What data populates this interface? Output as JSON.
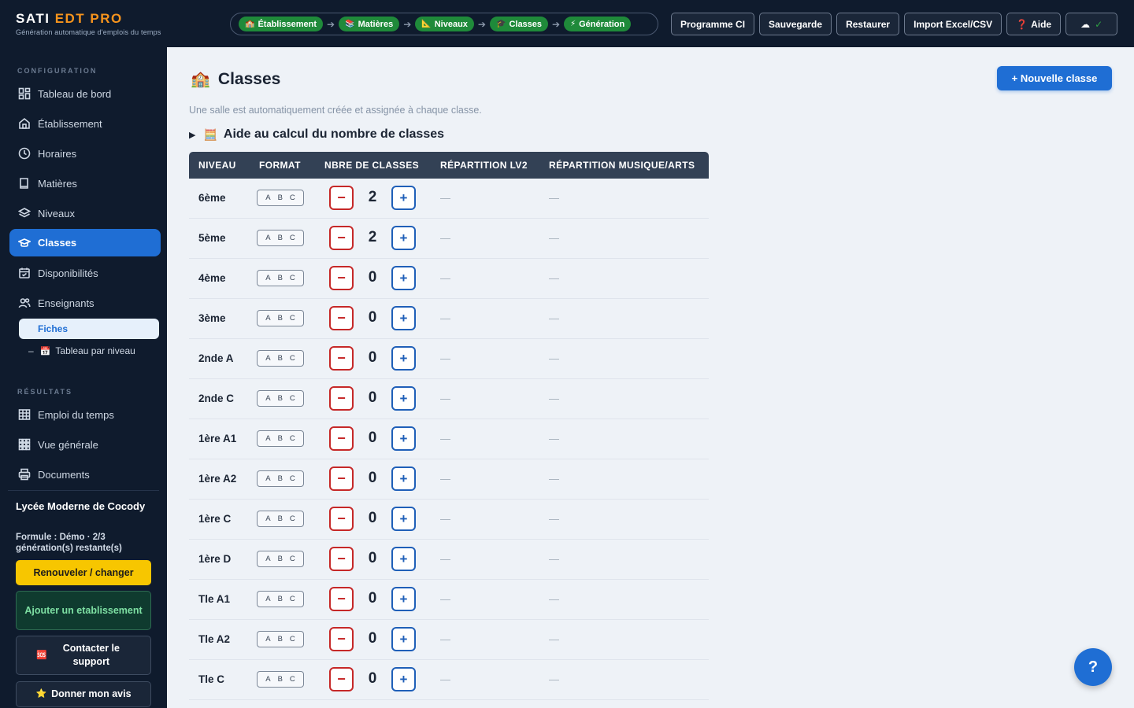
{
  "brand": {
    "title_main": "SATI ",
    "title_accent": "EDT PRO",
    "subtitle": "Génération automatique d'emplois du temps"
  },
  "wizard": {
    "steps": [
      {
        "icon": "🏫",
        "label": "Établissement"
      },
      {
        "icon": "📚",
        "label": "Matières"
      },
      {
        "icon": "📐",
        "label": "Niveaux"
      },
      {
        "icon": "🎓",
        "label": "Classes"
      },
      {
        "icon": "⚡",
        "label": "Génération"
      }
    ],
    "arrow": "➔"
  },
  "top_actions": {
    "programme": "Programme CI",
    "sauvegarde": "Sauvegarde",
    "restaurer": "Restaurer",
    "import": "Import Excel/CSV",
    "aide_icon": "❓",
    "aide": "Aide",
    "cloud_icon": "☁",
    "cloud_check": "✓"
  },
  "sidebar": {
    "config_label": "CONFIGURATION",
    "results_label": "RÉSULTATS",
    "items": [
      {
        "label": "Tableau de bord",
        "icon": "dashboard-icon"
      },
      {
        "label": "Établissement",
        "icon": "home-icon"
      },
      {
        "label": "Horaires",
        "icon": "clock-icon"
      },
      {
        "label": "Matières",
        "icon": "book-icon"
      },
      {
        "label": "Niveaux",
        "icon": "layers-icon"
      },
      {
        "label": "Classes",
        "icon": "graduation-cap-icon"
      },
      {
        "label": "Disponibilités",
        "icon": "calendar-icon"
      },
      {
        "label": "Enseignants",
        "icon": "users-icon"
      }
    ],
    "sub_fiches": "Fiches",
    "sub_dash": "–",
    "sub_tableau_icon": "📅",
    "sub_tableau": "Tableau par niveau",
    "results": [
      {
        "label": "Emploi du temps",
        "icon": "table-icon"
      },
      {
        "label": "Vue générale",
        "icon": "grid-icon"
      },
      {
        "label": "Documents",
        "icon": "printer-icon"
      }
    ],
    "school": "Lycée Moderne de Cocody",
    "formule": "Formule : Démo · 2/3 génération(s) restante(s)",
    "renew": "Renouveler / changer",
    "add_school": "Ajouter un etablissement",
    "support_icon": "🆘",
    "support": "Contacter le support",
    "avis_icon": "⭐",
    "avis": "Donner mon avis"
  },
  "main": {
    "title_icon": "🏫",
    "title": "Classes",
    "new_button": "+ Nouvelle classe",
    "subtitle": "Une salle est automatiquement créée et assignée à chaque classe.",
    "helper_triangle": "▶",
    "helper_icon": "🧮",
    "helper": "Aide au calcul du nombre de classes",
    "columns": [
      "NIVEAU",
      "FORMAT",
      "NBRE DE CLASSES",
      "RÉPARTITION LV2",
      "RÉPARTITION MUSIQUE/ARTS"
    ],
    "format_letters": [
      "A",
      "B",
      "C"
    ],
    "minus": "−",
    "plus": "+",
    "empty": "—",
    "rows": [
      {
        "level": "6ème",
        "count": "2"
      },
      {
        "level": "5ème",
        "count": "2"
      },
      {
        "level": "4ème",
        "count": "0"
      },
      {
        "level": "3ème",
        "count": "0"
      },
      {
        "level": "2nde A",
        "count": "0"
      },
      {
        "level": "2nde C",
        "count": "0"
      },
      {
        "level": "1ère A1",
        "count": "0"
      },
      {
        "level": "1ère A2",
        "count": "0"
      },
      {
        "level": "1ère C",
        "count": "0"
      },
      {
        "level": "1ère D",
        "count": "0"
      },
      {
        "level": "Tle A1",
        "count": "0"
      },
      {
        "level": "Tle A2",
        "count": "0"
      },
      {
        "level": "Tle C",
        "count": "0"
      }
    ]
  },
  "fab": "?"
}
